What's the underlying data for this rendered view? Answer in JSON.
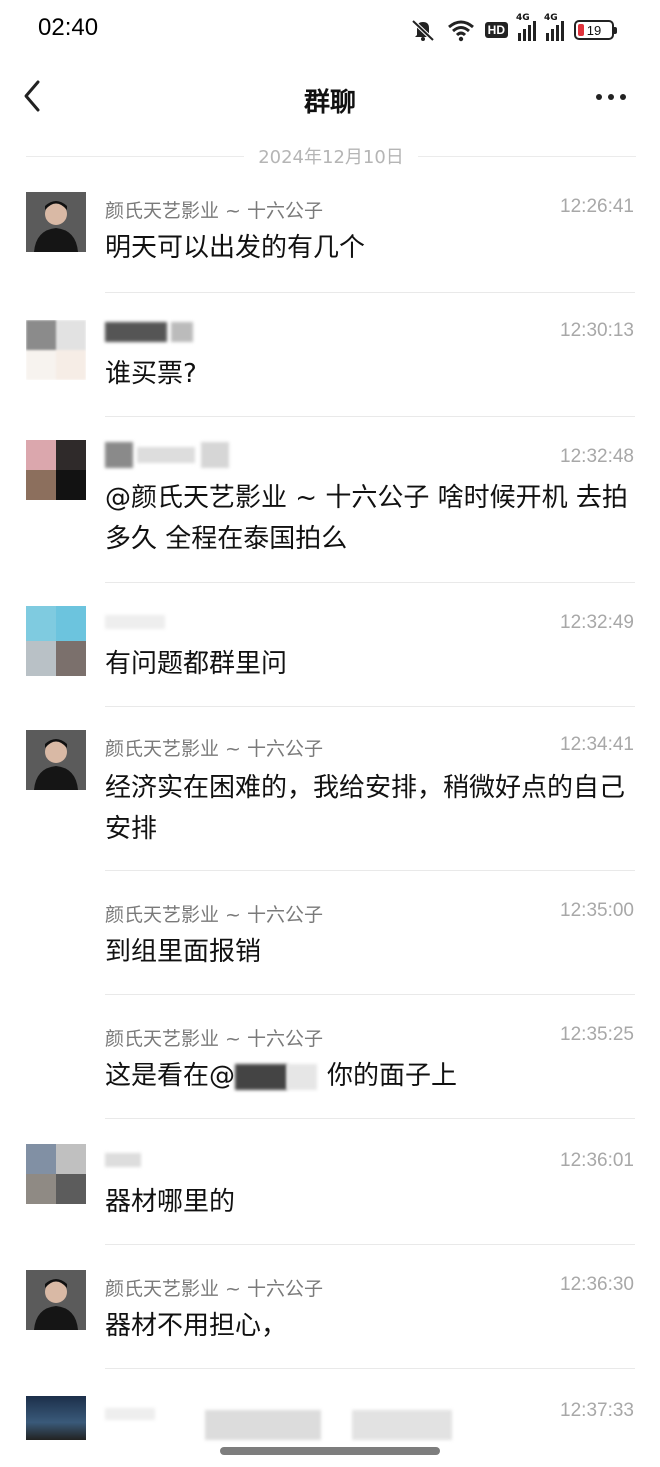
{
  "status_bar": {
    "time": "02:40",
    "hd_label": "HD",
    "net_label": "4G",
    "battery": "19"
  },
  "nav": {
    "title": "群聊"
  },
  "date_separator": "2024年12月10日",
  "messages": [
    {
      "sender": "颜氏天艺影业 ~ 十六公子",
      "time": "12:26:41",
      "text": "明天可以出发的有几个"
    },
    {
      "sender": "",
      "time": "12:30:13",
      "text": "谁买票?"
    },
    {
      "sender": "",
      "time": "12:32:48",
      "text": "@颜氏天艺影业 ~ 十六公子 啥时候开机 去拍多久   全程在泰国拍么"
    },
    {
      "sender": "",
      "time": "12:32:49",
      "text": "有问题都群里问"
    },
    {
      "sender": "颜氏天艺影业 ~ 十六公子",
      "time": "12:34:41",
      "text": "经济实在困难的，我给安排，稍微好点的自己安排"
    },
    {
      "sender": "颜氏天艺影业 ~ 十六公子",
      "time": "12:35:00",
      "text": "到组里面报销"
    },
    {
      "sender": "颜氏天艺影业 ~ 十六公子",
      "time": "12:35:25",
      "text_before": "这是看在@",
      "text_after": "你的面子上"
    },
    {
      "sender": "",
      "time": "12:36:01",
      "text": "器材哪里的"
    },
    {
      "sender": "颜氏天艺影业 ~ 十六公子",
      "time": "12:36:30",
      "text": "器材不用担心，"
    },
    {
      "sender": "",
      "time": "12:37:33",
      "text": ""
    }
  ]
}
